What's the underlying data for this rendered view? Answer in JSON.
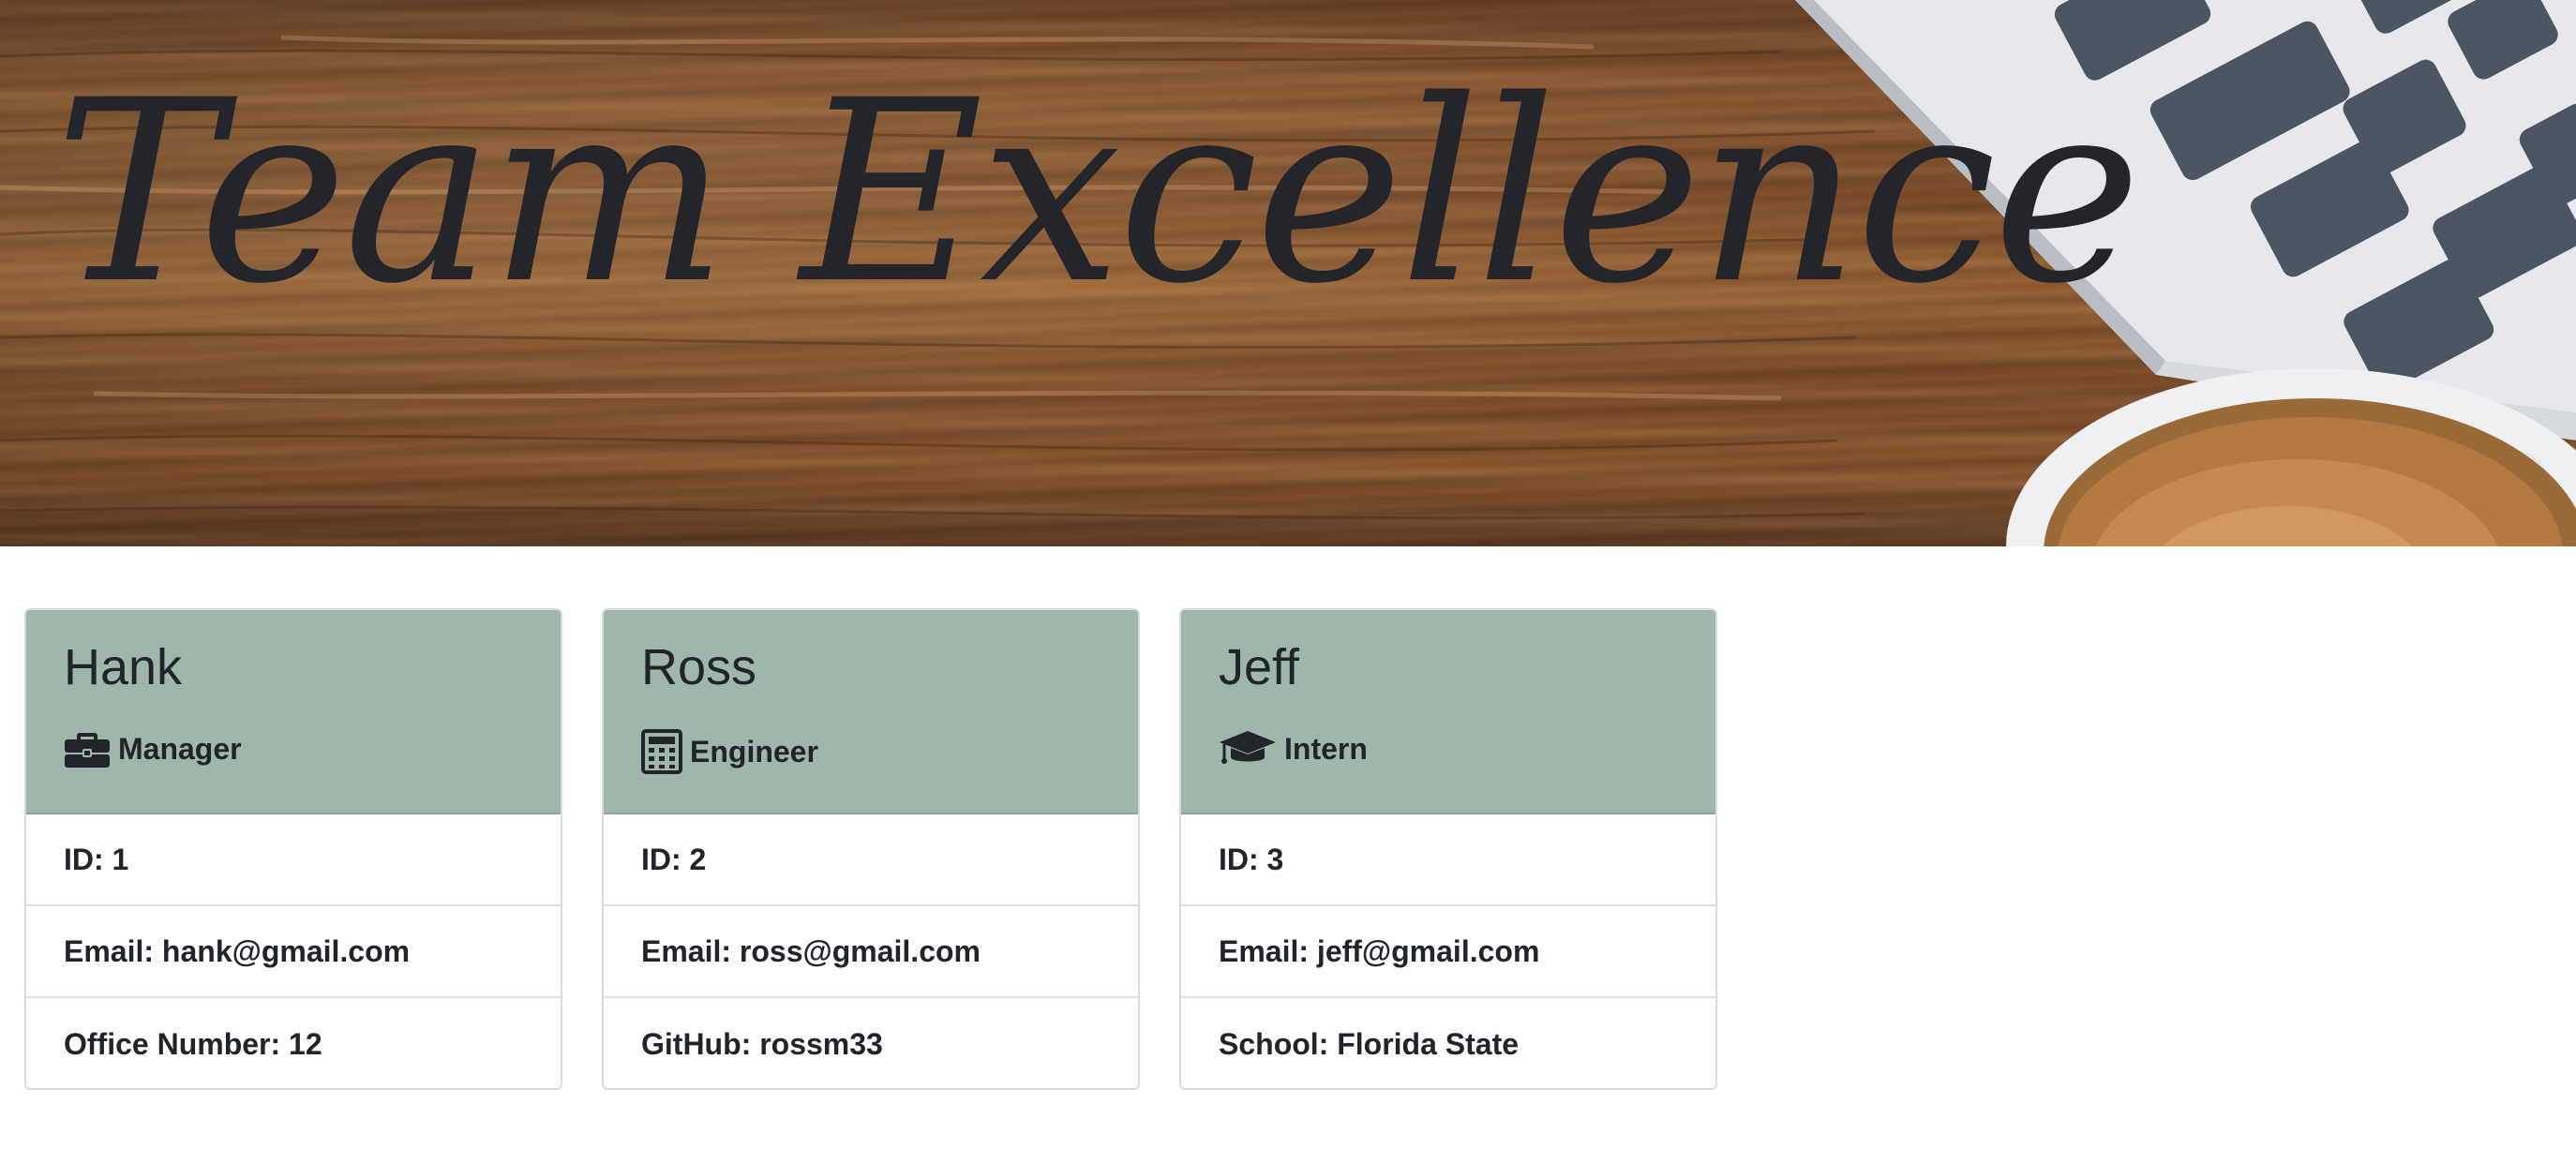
{
  "hero": {
    "title": "Team Excellence"
  },
  "team": [
    {
      "name": "Hank",
      "role": "Manager",
      "role_icon": "briefcase-icon",
      "id_text": "ID: 1",
      "email_text": "Email: hank@gmail.com",
      "extra_text": "Office Number: 12"
    },
    {
      "name": "Ross",
      "role": "Engineer",
      "role_icon": "calculator-icon",
      "id_text": "ID: 2",
      "email_text": "Email: ross@gmail.com",
      "extra_text": "GitHub: rossm33"
    },
    {
      "name": "Jeff",
      "role": "Intern",
      "role_icon": "graduation-cap-icon",
      "id_text": "ID: 3",
      "email_text": "Email: jeff@gmail.com",
      "extra_text": "School: Florida State"
    }
  ],
  "colors": {
    "card_header": "#9eb7aa",
    "text": "#212529",
    "border": "#d9dcde"
  }
}
